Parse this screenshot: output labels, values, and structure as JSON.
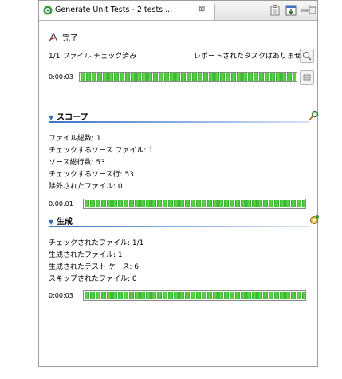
{
  "tab": {
    "title": "Generate Unit Tests - 2 tests ...",
    "close_symbol": "⊠"
  },
  "status": {
    "label": "完了",
    "checked": "1/1 ファイル チェック済み",
    "reported": "レポートされたタスクはありません"
  },
  "overall": {
    "time": "0:00:03",
    "progress": 1.0
  },
  "scope": {
    "title": "スコープ",
    "lines": [
      "ファイル総数: 1",
      "チェックするソース ファイル: 1",
      "ソース総行数: 53",
      "チェックするソース行: 53",
      "除外されたファイル: 0"
    ],
    "time": "0:00:01",
    "progress": 1.0
  },
  "generation": {
    "title": "生成",
    "lines": [
      "チェックされたファイル: 1/1",
      "生成されたファイル: 1",
      "生成されたテスト ケース: 6",
      "スキップされたファイル: 0"
    ],
    "time": "0:00:03",
    "progress": 1.0
  },
  "colors": {
    "accent": "#3b74c9",
    "progress": "#2fb12f"
  }
}
